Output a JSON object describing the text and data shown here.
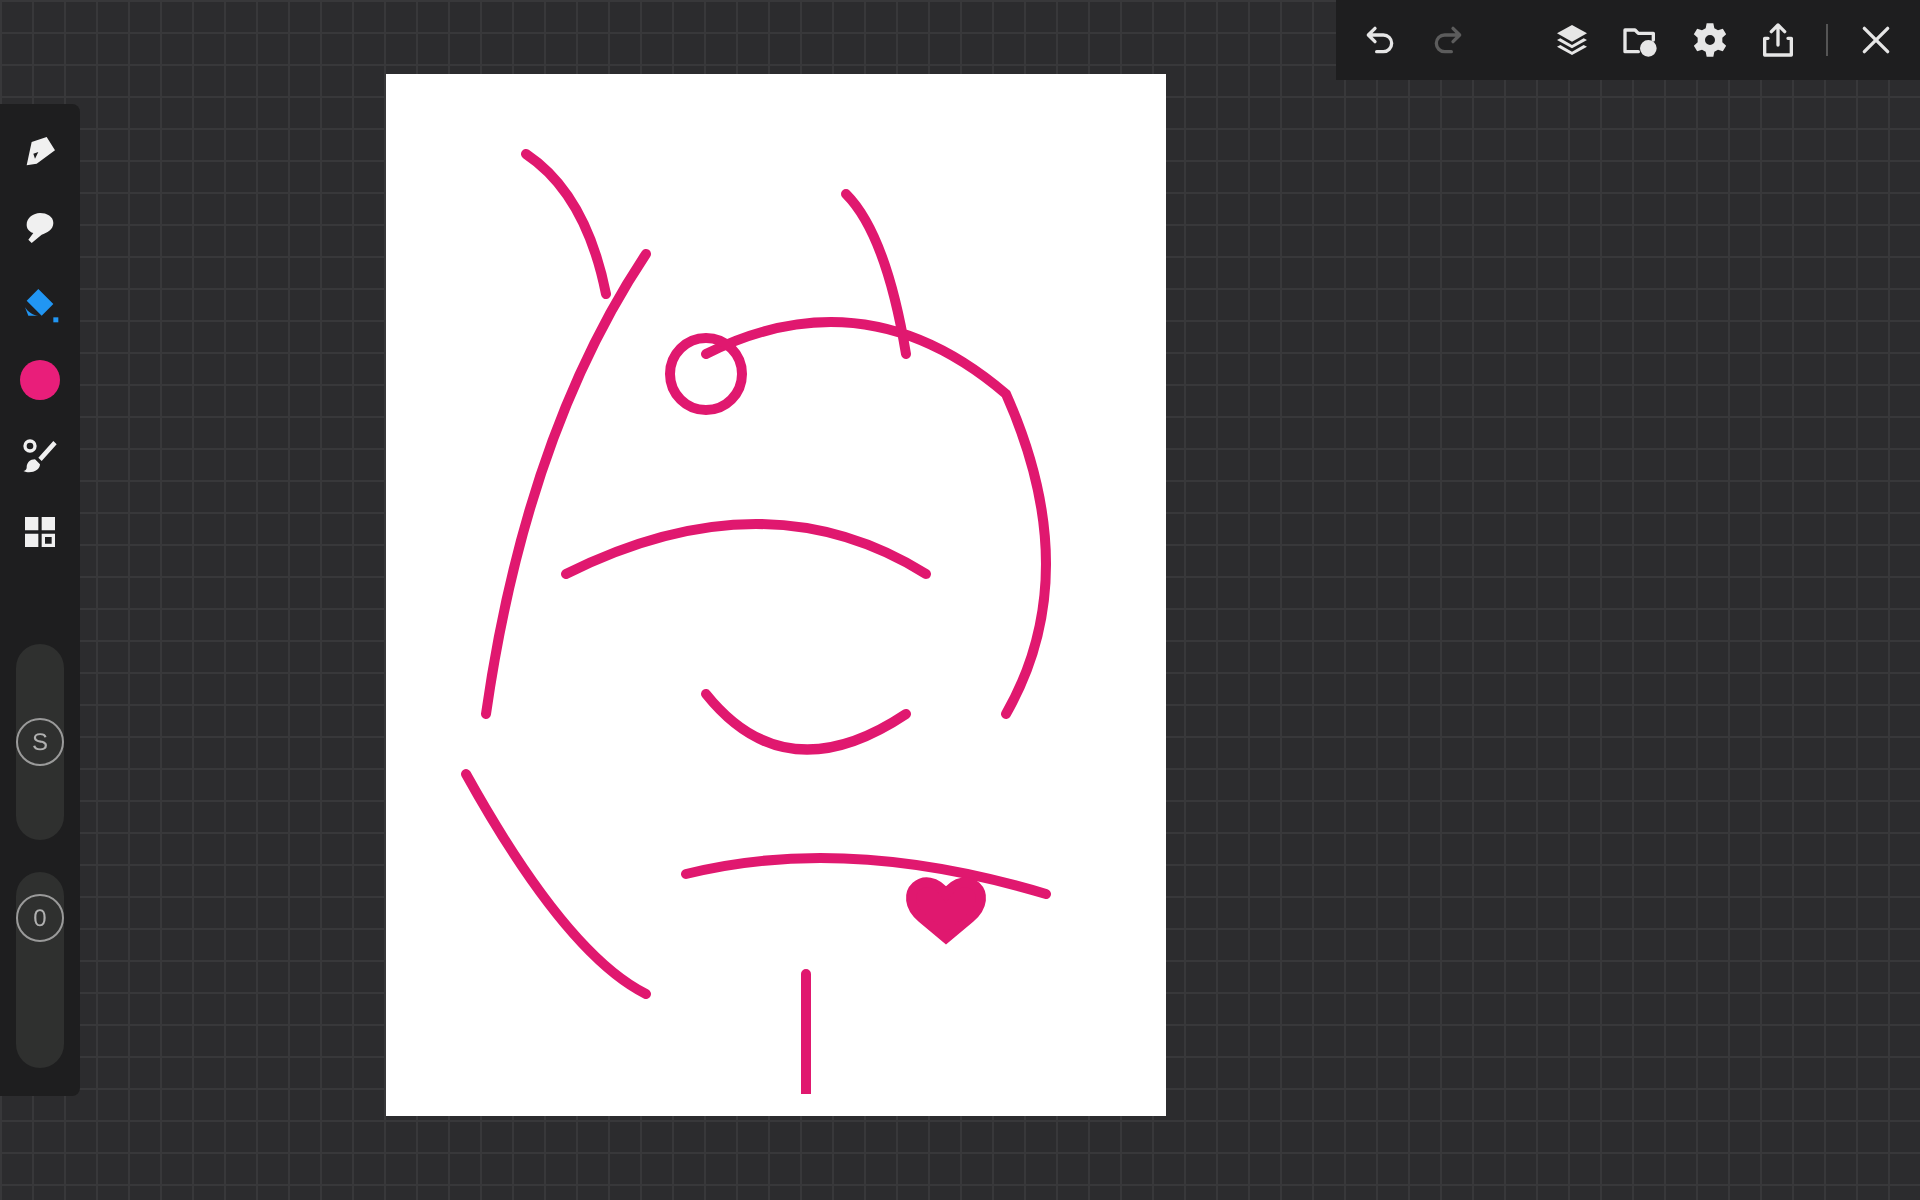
{
  "toolbar": {
    "actions": [
      {
        "kind": "undo",
        "disabled": false
      },
      {
        "kind": "redo",
        "disabled": true
      },
      {
        "kind": "layers",
        "disabled": false
      },
      {
        "kind": "gallery",
        "disabled": false
      },
      {
        "kind": "settings",
        "disabled": false
      },
      {
        "kind": "share",
        "disabled": false
      },
      {
        "kind": "close",
        "disabled": false
      }
    ]
  },
  "sidebar": {
    "tools": [
      {
        "kind": "pen",
        "selected": false
      },
      {
        "kind": "smudge",
        "selected": false
      },
      {
        "kind": "fill",
        "selected": true
      },
      {
        "kind": "color",
        "selected": false,
        "color": "#e91e7a"
      },
      {
        "kind": "brush",
        "selected": false
      },
      {
        "kind": "grid",
        "selected": false
      }
    ],
    "sliders": [
      {
        "label": "S",
        "level": 0.5
      },
      {
        "label": "0",
        "level": 0.85
      }
    ]
  }
}
